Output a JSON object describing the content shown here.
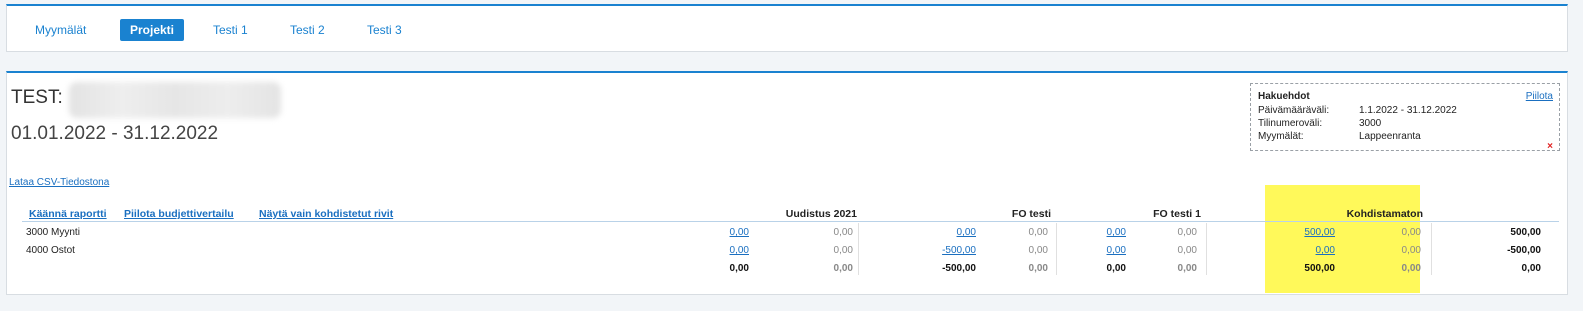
{
  "tabs": [
    {
      "label": "Myymälät",
      "active": false
    },
    {
      "label": "Projekti",
      "active": true
    },
    {
      "label": "Testi 1",
      "active": false
    },
    {
      "label": "Testi 2",
      "active": false
    },
    {
      "label": "Testi 3",
      "active": false
    }
  ],
  "report": {
    "title": "TEST:",
    "date_range": "01.01.2022 - 31.12.2022",
    "csv_link": "Lataa CSV-Tiedostona"
  },
  "criteria": {
    "title": "Hakuehdot",
    "hide_link": "Piilota",
    "rows": [
      {
        "label": "Päivämääräväli:",
        "value": "1.1.2022 - 31.12.2022"
      },
      {
        "label": "Tilinumeroväli:",
        "value": "3000"
      },
      {
        "label": "Myymälät:",
        "value": "Lappeenranta"
      }
    ],
    "remove_glyph": "×"
  },
  "actions": {
    "reverse": "Käännä raportti",
    "hide_budget": "Piilota budjettivertailu",
    "show_targeted": "Näytä vain kohdistetut rivit"
  },
  "columns": [
    "Uudistus 2021",
    "FO testi",
    "FO testi 1",
    "Kohdistamaton"
  ],
  "highlight_color": "#fff95a",
  "rows": [
    {
      "label": "3000 Myynti",
      "cells": [
        "0,00",
        "0,00",
        "0,00",
        "0,00",
        "0,00",
        "0,00",
        "500,00",
        "0,00",
        "500,00"
      ]
    },
    {
      "label": "4000 Ostot",
      "cells": [
        "0,00",
        "0,00",
        "-500,00",
        "0,00",
        "0,00",
        "0,00",
        "0,00",
        "0,00",
        "-500,00"
      ]
    }
  ],
  "totals": [
    "0,00",
    "0,00",
    "-500,00",
    "0,00",
    "0,00",
    "0,00",
    "500,00",
    "0,00",
    "0,00"
  ]
}
